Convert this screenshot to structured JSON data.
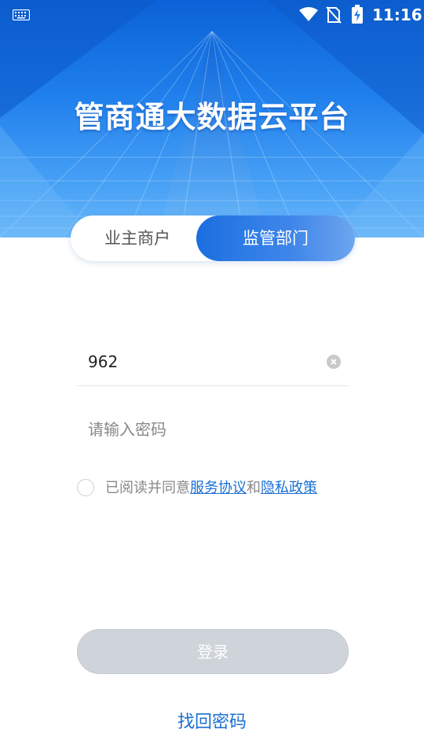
{
  "status_bar": {
    "time": "11:16",
    "icons": [
      "keyboard-icon",
      "wifi-icon",
      "no-sim-icon",
      "battery-charging-icon"
    ]
  },
  "header": {
    "title": "管商通大数据云平台"
  },
  "role_switch": {
    "tabs": [
      {
        "label": "业主商户",
        "selected": false
      },
      {
        "label": "监管部门",
        "selected": true
      }
    ]
  },
  "form": {
    "username_value": "962",
    "password_placeholder": "请输入密码",
    "agree_prefix": "已阅读并同意",
    "service_agreement": "服务协议",
    "agree_and": "和",
    "privacy_policy": "隐私政策",
    "login_label": "登录",
    "forgot_label": "找回密码"
  },
  "colors": {
    "accent": "#1b6fd1",
    "login_disabled": "#cfd3da"
  }
}
